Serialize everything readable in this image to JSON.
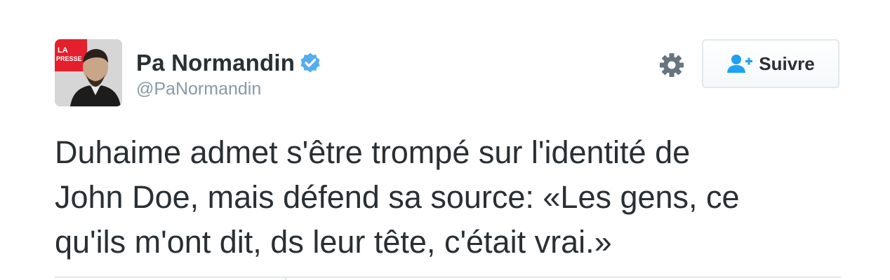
{
  "author": {
    "display_name": "Pa Normandin",
    "handle": "@PaNormandin",
    "verified": true,
    "avatar_badge_line1": "LA",
    "avatar_badge_line2": "PRESSE"
  },
  "actions": {
    "follow_label": "Suivre"
  },
  "tweet": {
    "text_lines": [
      "Duhaime admet s'être trompé sur l'identité de",
      "John Doe, mais défend sa source: «Les gens, ce",
      "qu'ils m'ont dit, ds leur tête, c'était vrai.»"
    ]
  },
  "colors": {
    "text": "#292f33",
    "muted": "#8899a6",
    "verified_blue": "#55acee",
    "follow_icon_blue": "#1da1f2",
    "border": "#e1e8ed",
    "badge_red": "#e4202e"
  },
  "icons": {
    "verified": "verified-badge-icon",
    "settings": "gear-icon",
    "follow": "person-add-icon"
  }
}
